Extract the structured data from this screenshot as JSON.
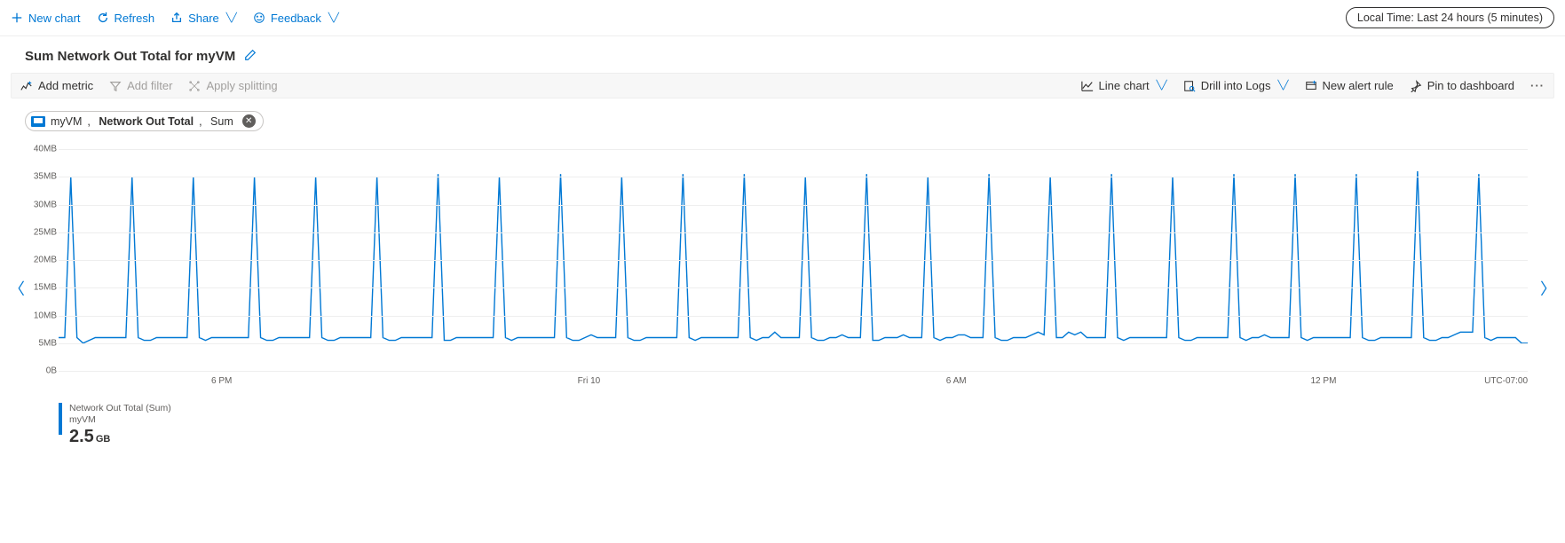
{
  "topbar": {
    "new_chart": "New chart",
    "refresh": "Refresh",
    "share": "Share",
    "feedback": "Feedback",
    "time_range": "Local Time: Last 24 hours (5 minutes)"
  },
  "chart": {
    "title": "Sum Network Out Total for myVM",
    "toolbar": {
      "add_metric": "Add metric",
      "add_filter": "Add filter",
      "apply_splitting": "Apply splitting",
      "line_chart": "Line chart",
      "drill_logs": "Drill into Logs",
      "new_alert": "New alert rule",
      "pin_dashboard": "Pin to dashboard"
    },
    "metric_pill": {
      "resource": "myVM",
      "metric": "Network Out Total",
      "aggregation": "Sum"
    },
    "legend": {
      "series": "Network Out Total (Sum)",
      "resource": "myVM",
      "value": "2.5",
      "unit": "GB"
    },
    "timezone": "UTC-07:00"
  },
  "chart_data": {
    "type": "line",
    "ylabel": "",
    "xlabel": "",
    "ylim": [
      0,
      40
    ],
    "y_unit": "MB",
    "y_ticks": [
      0,
      5,
      10,
      15,
      20,
      25,
      30,
      35,
      40
    ],
    "y_tick_labels": [
      "0B",
      "5MB",
      "10MB",
      "15MB",
      "20MB",
      "25MB",
      "30MB",
      "35MB",
      "40MB"
    ],
    "x_ticks": [
      {
        "pos": 0.111,
        "label": "6 PM"
      },
      {
        "pos": 0.361,
        "label": "Fri 10"
      },
      {
        "pos": 0.611,
        "label": "6 AM"
      },
      {
        "pos": 0.861,
        "label": "12 PM"
      }
    ],
    "series": [
      {
        "name": "Network Out Total (Sum) myVM",
        "color": "#0078d4",
        "values": [
          6,
          6,
          35,
          6,
          5,
          5.5,
          6,
          6,
          6,
          6,
          6,
          6,
          35,
          6,
          5.5,
          5.5,
          6,
          6,
          6,
          6,
          6,
          6,
          35,
          6,
          5.5,
          6,
          6,
          6,
          6,
          6,
          6,
          6,
          35,
          6,
          5.5,
          5.5,
          6,
          6,
          6,
          6,
          6,
          6,
          35,
          6,
          5.5,
          5.5,
          6,
          6,
          6,
          6,
          6,
          6,
          35,
          6,
          5.5,
          5.5,
          6,
          6,
          6,
          6,
          6,
          6,
          35.5,
          5.5,
          5.5,
          6,
          6,
          6,
          6,
          6,
          6,
          6,
          35,
          6,
          5.5,
          6,
          6,
          6,
          6,
          6,
          6,
          6,
          35.5,
          6,
          5.5,
          5.5,
          6,
          6.5,
          6,
          6,
          6,
          6,
          35,
          6,
          5.5,
          5.5,
          6,
          6,
          6,
          6,
          6,
          6,
          35.5,
          6,
          5.5,
          6,
          6,
          6,
          6,
          6,
          6,
          6,
          35.5,
          6,
          5.5,
          6,
          6,
          7,
          6,
          6,
          6,
          6,
          35,
          6,
          5.5,
          5.5,
          6,
          6,
          6.5,
          6,
          6,
          6,
          35.5,
          5.5,
          5.5,
          6,
          6,
          6,
          6.5,
          6,
          6,
          6,
          35,
          6,
          5.5,
          6,
          6,
          6.5,
          6.5,
          6,
          6,
          6,
          35.5,
          6,
          5.5,
          5.5,
          6,
          6,
          6,
          6.5,
          7,
          6.5,
          35,
          6,
          6,
          7,
          6.5,
          7,
          6,
          6,
          6,
          6,
          35.5,
          6,
          5.5,
          6,
          6,
          6,
          6,
          6,
          6,
          6,
          35,
          6,
          5.5,
          5.5,
          6,
          6,
          6,
          6,
          6,
          6,
          35.5,
          6,
          5.5,
          6,
          6,
          6.5,
          6,
          6,
          6,
          6,
          35.5,
          6,
          5.5,
          6,
          6,
          6,
          6,
          6,
          6,
          6,
          35.5,
          6,
          5.5,
          5.5,
          6,
          6,
          6,
          6,
          6,
          6,
          36,
          6,
          5.5,
          5.5,
          6,
          6,
          6.5,
          7,
          7,
          7,
          35.5,
          6,
          5.5,
          6,
          6,
          6,
          6,
          5,
          5
        ]
      }
    ]
  }
}
